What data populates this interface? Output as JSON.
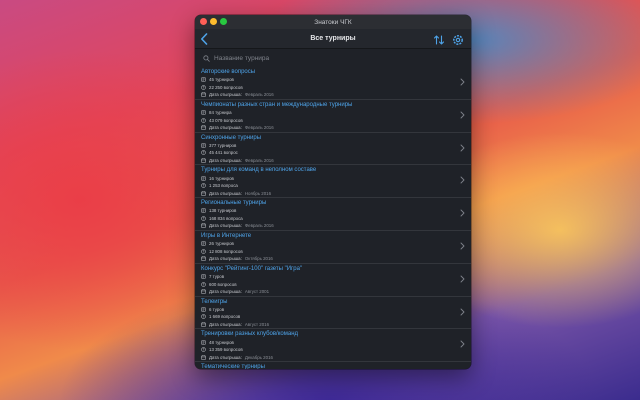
{
  "window": {
    "title": "Знатоки ЧГК"
  },
  "navbar": {
    "title": "Все турниры"
  },
  "search": {
    "placeholder": "Название турнира"
  },
  "list": [
    {
      "title": "Авторские вопросы",
      "tournaments": "45 турниров",
      "questions": "22 250 вопросов",
      "date_label": "Дата отыгрыша:",
      "date": "Февраль 2016"
    },
    {
      "title": "Чемпионаты разных стран и международные турниры",
      "tournaments": "84 турнира",
      "questions": "43 079 вопросов",
      "date_label": "Дата отыгрыша:",
      "date": "Февраль 2016"
    },
    {
      "title": "Синхронные турниры",
      "tournaments": "377 турниров",
      "questions": "45 441 вопрос",
      "date_label": "Дата отыгрыша:",
      "date": "Февраль 2016"
    },
    {
      "title": "Турниры для команд в неполном составе",
      "tournaments": "16 турниров",
      "questions": "1 253 вопроса",
      "date_label": "Дата отыгрыша:",
      "date": "Ноябрь 2016"
    },
    {
      "title": "Региональные турниры",
      "tournaments": "138 турниров",
      "questions": "168 834 вопроса",
      "date_label": "Дата отыгрыша:",
      "date": "Февраль 2016"
    },
    {
      "title": "Игры в Интернете",
      "tournaments": "26 турниров",
      "questions": "12 808 вопросов",
      "date_label": "Дата отыгрыша:",
      "date": "Октябрь 2016"
    },
    {
      "title": "Конкурс \"Рейтинг-100\" газеты \"Игра\"",
      "tournaments": "7 туров",
      "questions": "600 вопросов",
      "date_label": "Дата отыгрыша:",
      "date": "Август 2001"
    },
    {
      "title": "Телеигры",
      "tournaments": "6 туров",
      "questions": "1 669 вопросов",
      "date_label": "Дата отыгрыша:",
      "date": "Август 2016"
    },
    {
      "title": "Тренировки разных клубов/команд",
      "tournaments": "48 турниров",
      "questions": "13 359 вопросов",
      "date_label": "Дата отыгрыша:",
      "date": "Декабрь 2016"
    },
    {
      "title": "Тематические турниры",
      "tournaments": "",
      "questions": "",
      "date_label": "",
      "date": ""
    }
  ]
}
